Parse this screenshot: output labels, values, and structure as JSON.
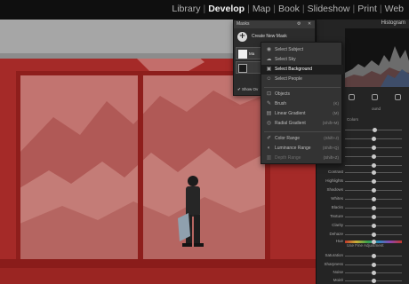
{
  "top_bar": {
    "modules": [
      {
        "label": "Library",
        "active": false
      },
      {
        "label": "Develop",
        "active": true
      },
      {
        "label": "Map",
        "active": false
      },
      {
        "label": "Book",
        "active": false
      },
      {
        "label": "Slideshow",
        "active": false
      },
      {
        "label": "Print",
        "active": false
      },
      {
        "label": "Web",
        "active": false
      }
    ],
    "separator": "|"
  },
  "masks_panel": {
    "title": "Masks",
    "create_label": "Create New Mask",
    "mask_item_label": "Ma",
    "show_overlay_label": "Show Ov"
  },
  "mask_menu": {
    "items": [
      {
        "label": "Select Subject",
        "shortcut": "",
        "icon": "subject-icon",
        "glyph": "◉",
        "highlighted": false,
        "disabled": false
      },
      {
        "label": "Select Sky",
        "shortcut": "",
        "icon": "sky-icon",
        "glyph": "☁",
        "highlighted": false,
        "disabled": false
      },
      {
        "label": "Select Background",
        "shortcut": "",
        "icon": "background-icon",
        "glyph": "▣",
        "highlighted": true,
        "disabled": false
      },
      {
        "label": "Select People",
        "shortcut": "",
        "icon": "people-icon",
        "glyph": "☺",
        "highlighted": false,
        "disabled": false
      },
      {
        "label": "Objects",
        "shortcut": "",
        "icon": "objects-icon",
        "glyph": "⊡",
        "highlighted": false,
        "disabled": false
      },
      {
        "label": "Brush",
        "shortcut": "(K)",
        "icon": "brush-icon",
        "glyph": "✎",
        "highlighted": false,
        "disabled": false
      },
      {
        "label": "Linear Gradient",
        "shortcut": "(M)",
        "icon": "linear-gradient-icon",
        "glyph": "▤",
        "highlighted": false,
        "disabled": false
      },
      {
        "label": "Radial Gradient",
        "shortcut": "(Shift+M)",
        "icon": "radial-gradient-icon",
        "glyph": "◎",
        "highlighted": false,
        "disabled": false
      },
      {
        "label": "Color Range",
        "shortcut": "(Shift+J)",
        "icon": "color-range-icon",
        "glyph": "✐",
        "highlighted": false,
        "disabled": false
      },
      {
        "label": "Luminance Range",
        "shortcut": "(Shift+Q)",
        "icon": "luminance-range-icon",
        "glyph": "◐",
        "highlighted": false,
        "disabled": false
      },
      {
        "label": "Depth Range",
        "shortcut": "(Shift+Z)",
        "icon": "depth-range-icon",
        "glyph": "▥",
        "highlighted": false,
        "disabled": true
      }
    ]
  },
  "right_panel": {
    "histogram_label": "Histogram",
    "preset_label": "ound",
    "color_label": "Colors",
    "use_fine_label": "Use Fine Adjustment",
    "sliders": [
      {
        "label": "Contrast",
        "value": 0.5
      },
      {
        "label": "Highlights",
        "value": 0.5
      },
      {
        "label": "Shadows",
        "value": 0.5
      },
      {
        "label": "Whites",
        "value": 0.5
      },
      {
        "label": "Blacks",
        "value": 0.5
      },
      {
        "label": "Texture",
        "value": 0.5
      },
      {
        "label": "Clarity",
        "value": 0.5
      },
      {
        "label": "Dehaze",
        "value": 0.5
      },
      {
        "label": "Hue",
        "value": 0.5
      },
      {
        "label": "Saturation",
        "value": 0.5
      },
      {
        "label": "Sharpness",
        "value": 0.5
      },
      {
        "label": "Noise",
        "value": 0.5
      },
      {
        "label": "Moiré",
        "value": 0.5
      }
    ],
    "upper_sliders": [
      {
        "label": "",
        "value": 0.52
      },
      {
        "label": "",
        "value": 0.5
      },
      {
        "label": "",
        "value": 0.5
      },
      {
        "label": "",
        "value": 0.5
      },
      {
        "label": "",
        "value": 0.5
      }
    ]
  },
  "colors": {
    "mask_overlay": "#b03a38",
    "accent": "#e34a44",
    "panel_bg": "#242424"
  }
}
